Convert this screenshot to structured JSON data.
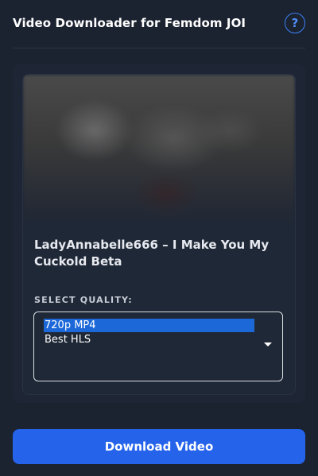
{
  "header": {
    "title": "Video Downloader for Femdom JOI",
    "help_label": "?"
  },
  "video": {
    "title": "LadyAnnabelle666 – I Make You My Cuckold Beta"
  },
  "quality": {
    "label": "SELECT QUALITY:",
    "options": [
      "720p MP4",
      "Best HLS"
    ],
    "selected": "720p MP4"
  },
  "actions": {
    "download_label": "Download Video"
  },
  "colors": {
    "accent": "#2563eb",
    "background": "#1b2230",
    "selected_option": "#1d68d8"
  }
}
